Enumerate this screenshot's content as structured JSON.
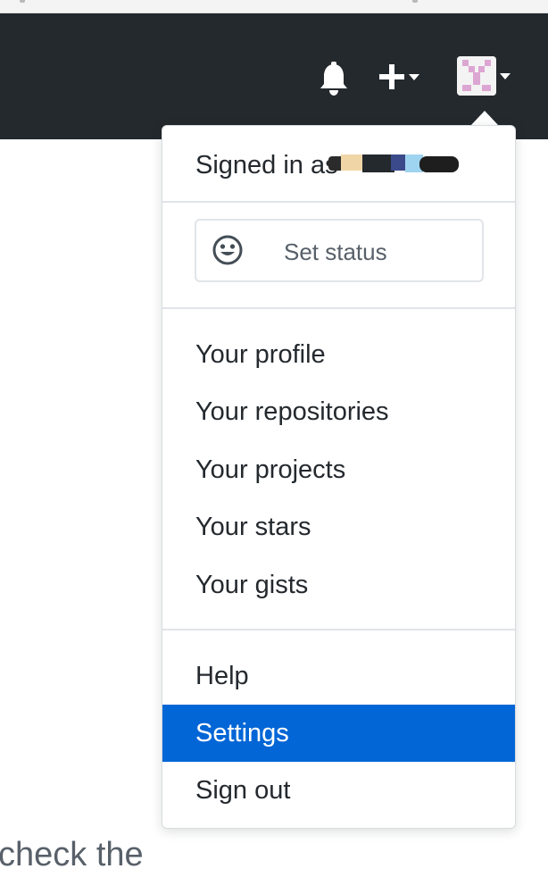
{
  "header": {
    "notifications_icon": "bell-icon",
    "create_icon": "plus-icon",
    "avatar_icon": "user-avatar"
  },
  "dropdown": {
    "signed_in_text": "Signed in as",
    "set_status_label": "Set status",
    "status_icon": "smiley-icon",
    "items": [
      {
        "label": "Your profile"
      },
      {
        "label": "Your repositories"
      },
      {
        "label": "Your projects"
      },
      {
        "label": "Your stars"
      },
      {
        "label": "Your gists"
      },
      {
        "label": "Help"
      },
      {
        "label": "Settings",
        "active": true
      },
      {
        "label": "Sign out"
      }
    ]
  },
  "background": {
    "partial_text": "check the"
  },
  "colors": {
    "header_bg": "#24292e",
    "active_bg": "#0366d6",
    "text": "#24292e",
    "muted_text": "#586069"
  }
}
